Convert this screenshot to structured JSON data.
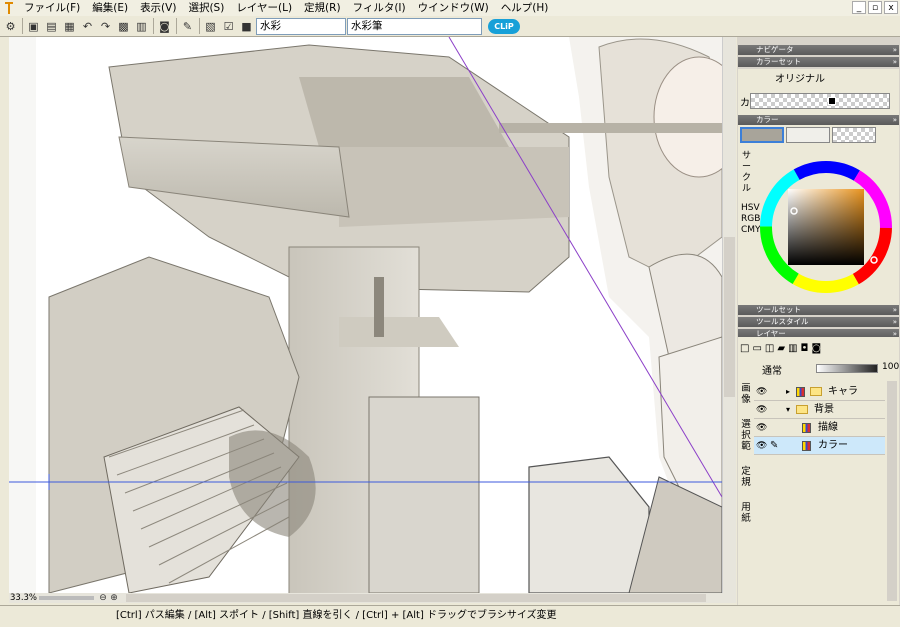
{
  "menu": [
    "ファイル(F)",
    "編集(E)",
    "表示(V)",
    "選択(S)",
    "レイヤー(L)",
    "定規(R)",
    "フィルタ(I)",
    "ウインドウ(W)",
    "ヘルプ(H)"
  ],
  "window_controls": [
    "_",
    "▫",
    "x"
  ],
  "toolbar": {
    "brush_category": "水彩",
    "brush_name": "水彩筆",
    "logo": "CLiP"
  },
  "zoom": "33.3%",
  "status": "[Ctrl] パス編集 / [Alt] スポイト / [Shift] 直線を引く / [Ctrl] + [Alt] ドラッグでブラシサイズ変更",
  "panels": {
    "navigator": "ナビゲータ",
    "colorset": "カラーセット",
    "colorset_name": "オリジナル",
    "colorset_label": "カ",
    "color": "カラー",
    "color_mode_tabs": "サークル",
    "color_mode_tabs_rotated": "HSV RGB CMY",
    "toolset": "ツールセット",
    "toolstyle": "ツールスタイル",
    "layer": "レイヤー",
    "blend_mode": "通常",
    "opacity": "100",
    "side_tabs": {
      "t1": "画像",
      "t2": "選択範",
      "t3": "定規",
      "t4": "用紙"
    },
    "layers": [
      {
        "name": "キャラ",
        "type": "folder"
      },
      {
        "name": "背景",
        "type": "folder"
      },
      {
        "name": "描線",
        "type": "raster"
      },
      {
        "name": "カラー",
        "type": "raster"
      }
    ]
  },
  "colors": {
    "accent": "#17a0d8",
    "selected_layer": "#cde8fa",
    "guide": "#8c40c8",
    "hguide": "#3c5adc"
  }
}
